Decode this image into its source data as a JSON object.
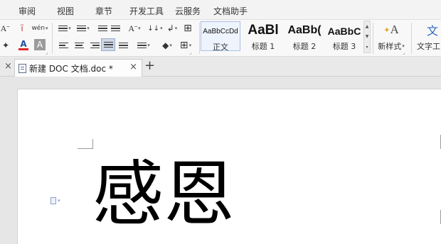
{
  "menu": {
    "items": [
      "审阅",
      "视图",
      "章节",
      "开发工具",
      "云服务",
      "文档助手"
    ]
  },
  "ribbon": {
    "glyphs": {
      "font_grow": "Aˉ",
      "font_color": "A",
      "char_shading": "A",
      "highlight": "✦",
      "text_effect": "ï",
      "phonetic": "wén",
      "font_size_aa": "Aˉ",
      "sort": "↓↓",
      "table_grid": "⊞",
      "borders": "⊞",
      "shading": "◆",
      "new_style": "A",
      "text_tools": "文"
    },
    "styles": [
      {
        "preview": "AaBbCcDd",
        "caption": "正文"
      },
      {
        "preview": "AaBl",
        "caption": "标题 1"
      },
      {
        "preview": "AaBb(",
        "caption": "标题 2"
      },
      {
        "preview": "AaBbC",
        "caption": "标题 3"
      }
    ],
    "new_style_label": "新样式",
    "text_tools_label": "文字工",
    "colors": {
      "font_color_bar": "#e32626",
      "highlight_bar": "#f0e25a",
      "new_style_icon": "#e5a22b",
      "text_tools_icon": "#2f6bc2"
    }
  },
  "tabs": {
    "document_title": "新建 DOC 文档.doc *",
    "close_all_glyph": "×",
    "close_glyph": "×",
    "new_tab_glyph": "+"
  },
  "document": {
    "text": "感恩"
  }
}
